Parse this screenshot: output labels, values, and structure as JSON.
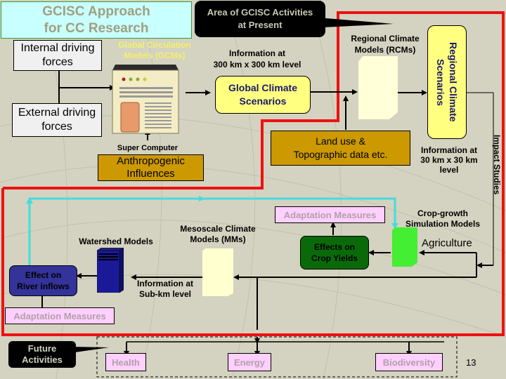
{
  "title": {
    "line1": "GCISC Approach",
    "line2": "for CC Research"
  },
  "callout_present": {
    "line1": "Area of GCISC Activities",
    "line2": "at Present"
  },
  "callout_future": {
    "line1": "Future",
    "line2": "Activities"
  },
  "internal_forces": {
    "line1": "Internal driving",
    "line2": "forces"
  },
  "external_forces": {
    "line1": "External driving",
    "line2": "forces"
  },
  "gcm_label": {
    "line1": "Global Circulation",
    "line2": "Models (GCMs)"
  },
  "super_computer": "Super Computer",
  "anthropogenic": {
    "line1": "Anthropogenic",
    "line2": "Influences"
  },
  "info_300": {
    "line1": "Information at",
    "line2": "300 km x 300 km level"
  },
  "global_scenarios": {
    "line1": "Global Climate",
    "line2": "Scenarios"
  },
  "rcm_label": {
    "line1": "Regional Climate",
    "line2": "Models (RCMs)"
  },
  "regional_scenarios": {
    "line1": "Regional Climate",
    "line2": "Scenarios"
  },
  "land_use": {
    "line1": "Land use &",
    "line2": "Topographic data etc."
  },
  "info_30": {
    "line1": "Information at",
    "line2": "30 km  x 30 km",
    "line3": "level"
  },
  "impact_studies": "Impact Studies",
  "adaptation_top": "Adaptation Measures",
  "crop_models": {
    "line1": "Crop-growth",
    "line2": "Simulation Models"
  },
  "agriculture": "Agriculture",
  "crop_yields": {
    "line1": "Effects on",
    "line2": "Crop Yields"
  },
  "mesoscale": {
    "line1": "Mesoscale Climate",
    "line2": "Models (MMs)"
  },
  "watershed": "Watershed Models",
  "river_inflows": {
    "line1": "Effect on",
    "line2": "River inflows"
  },
  "info_subkm": {
    "line1": "Information at",
    "line2": "Sub-km level"
  },
  "adaptation_bottom": "Adaptation Measures",
  "future_items": [
    "Health",
    "Energy",
    "Biodiversity"
  ],
  "page_number": "13",
  "colors": {
    "background": "#d4d2c0",
    "red_boundary": "#ee1111",
    "cyan_flow": "#44dddd",
    "gold": "#cc9900",
    "yellow": "#ffff80",
    "pink": "#ffd0ff",
    "green_dark": "#0a6a0a",
    "green_light": "#44ee33",
    "navy": "#333399"
  }
}
